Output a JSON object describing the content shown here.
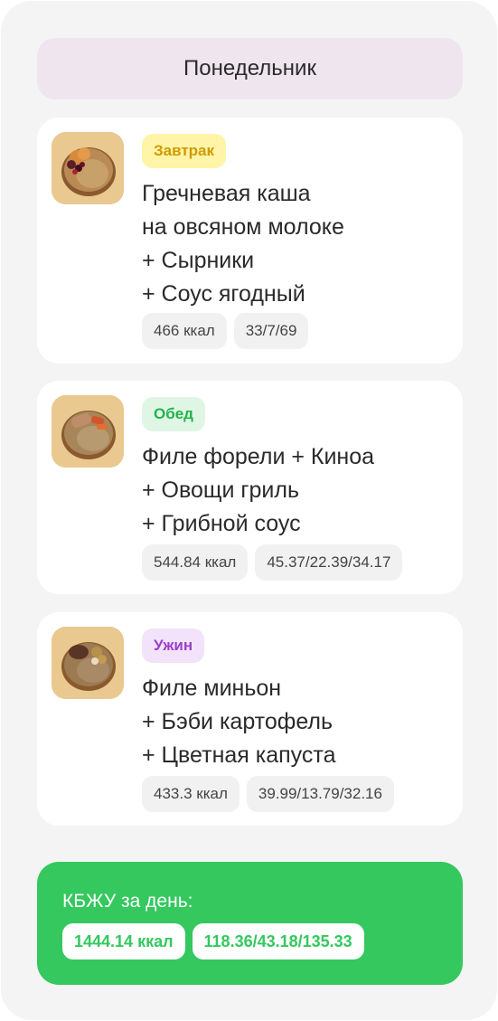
{
  "day": {
    "title": "Понедельник"
  },
  "meals": [
    {
      "type_label": "Завтрак",
      "image_icon": "porridge-bowl-with-syrniki-icon",
      "title_lines": [
        "Гречневая каша",
        "на овсяном молоке",
        "+ Сырники",
        "+ Соус ягодный"
      ],
      "kcal": "466 ккал",
      "macros": "33/7/69"
    },
    {
      "type_label": "Обед",
      "image_icon": "trout-quinoa-bowl-icon",
      "title_lines": [
        "Филе форели + Киноа",
        "+ Овощи гриль",
        "+ Грибной соус"
      ],
      "kcal": "544.84 ккал",
      "macros": "45.37/22.39/34.17"
    },
    {
      "type_label": "Ужин",
      "image_icon": "mignon-potato-bowl-icon",
      "title_lines": [
        "Филе миньон",
        "+ Бэби картофель",
        "+ Цветная капуста"
      ],
      "kcal": "433.3 ккал",
      "macros": "39.99/13.79/32.16"
    }
  ],
  "summary": {
    "title": "КБЖУ за день:",
    "kcal": "1444.14 ккал",
    "macros": "118.36/43.18/135.33"
  },
  "colors": {
    "accent_green": "#34c85e",
    "breakfast_badge": "#fff4a8",
    "lunch_badge": "#e0f6e5",
    "dinner_badge": "#f2e3fb",
    "header_bg": "#efe5ef"
  }
}
